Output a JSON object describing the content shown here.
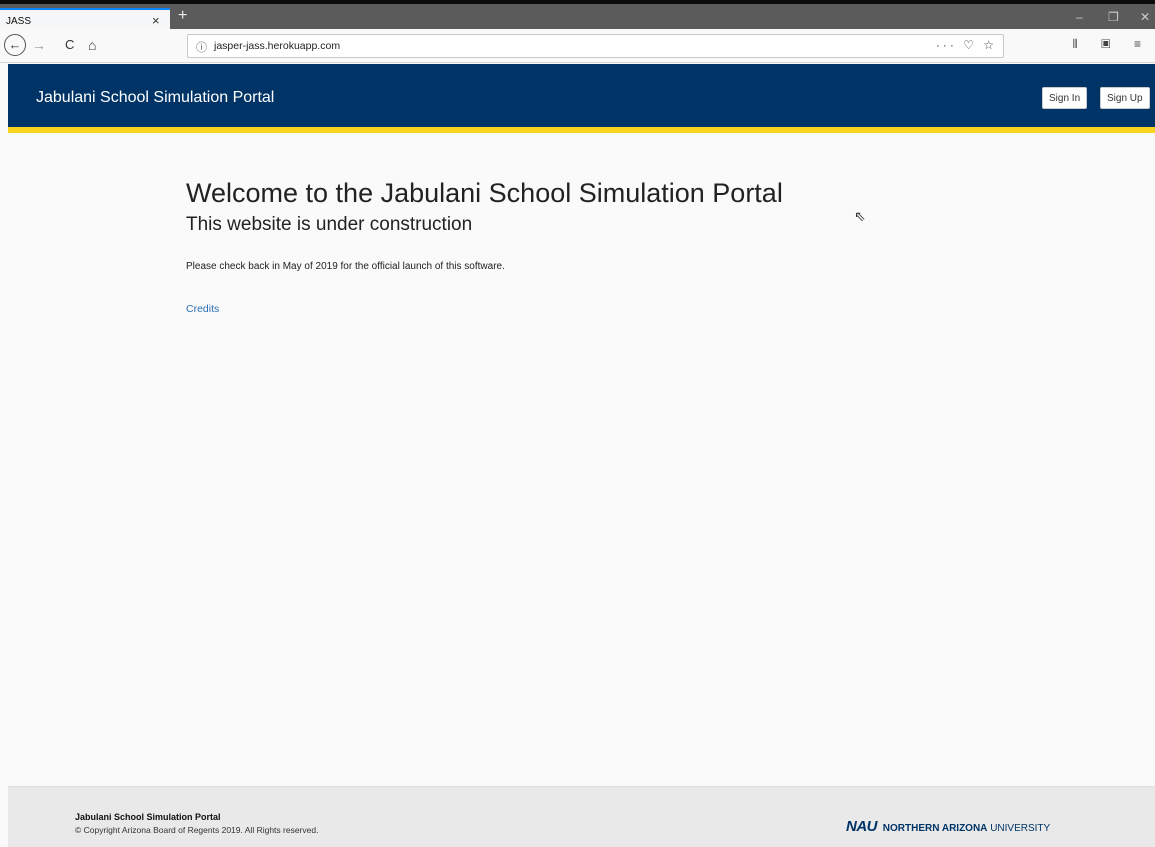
{
  "browser": {
    "tab_title": "JASS",
    "tab_close": "×",
    "new_tab": "+",
    "win_controls": [
      "–",
      "❐",
      "✕"
    ],
    "nav": {
      "back": "←",
      "forward": "→",
      "reload": "C",
      "home": "⌂"
    },
    "url_info": "ⓘ",
    "url": "jasper-jass.herokuapp.com",
    "url_actions": "··· ♡ ☆",
    "toolbar_icons": "⦀ ▣ ≡"
  },
  "header": {
    "brand": "Jabulani School Simulation Portal",
    "sign_in": "Sign In",
    "sign_up": "Sign Up"
  },
  "main": {
    "title": "Welcome to the Jabulani School Simulation Portal",
    "subtitle": "This website is under construction",
    "notice": "Please check back in May of 2019 for the official launch of this software.",
    "credits_link": "Credits"
  },
  "footer": {
    "title": "Jabulani School Simulation Portal",
    "copyright": "© Copyright Arizona Board of Regents 2019. All Rights reserved.",
    "logo_mark": "NAU",
    "logo_bold": "NORTHERN ARIZONA",
    "logo_rest": "UNIVERSITY"
  },
  "colors": {
    "header_bg": "#003466",
    "header_stripe": "#f8d51c",
    "link": "#2a6fb5"
  }
}
